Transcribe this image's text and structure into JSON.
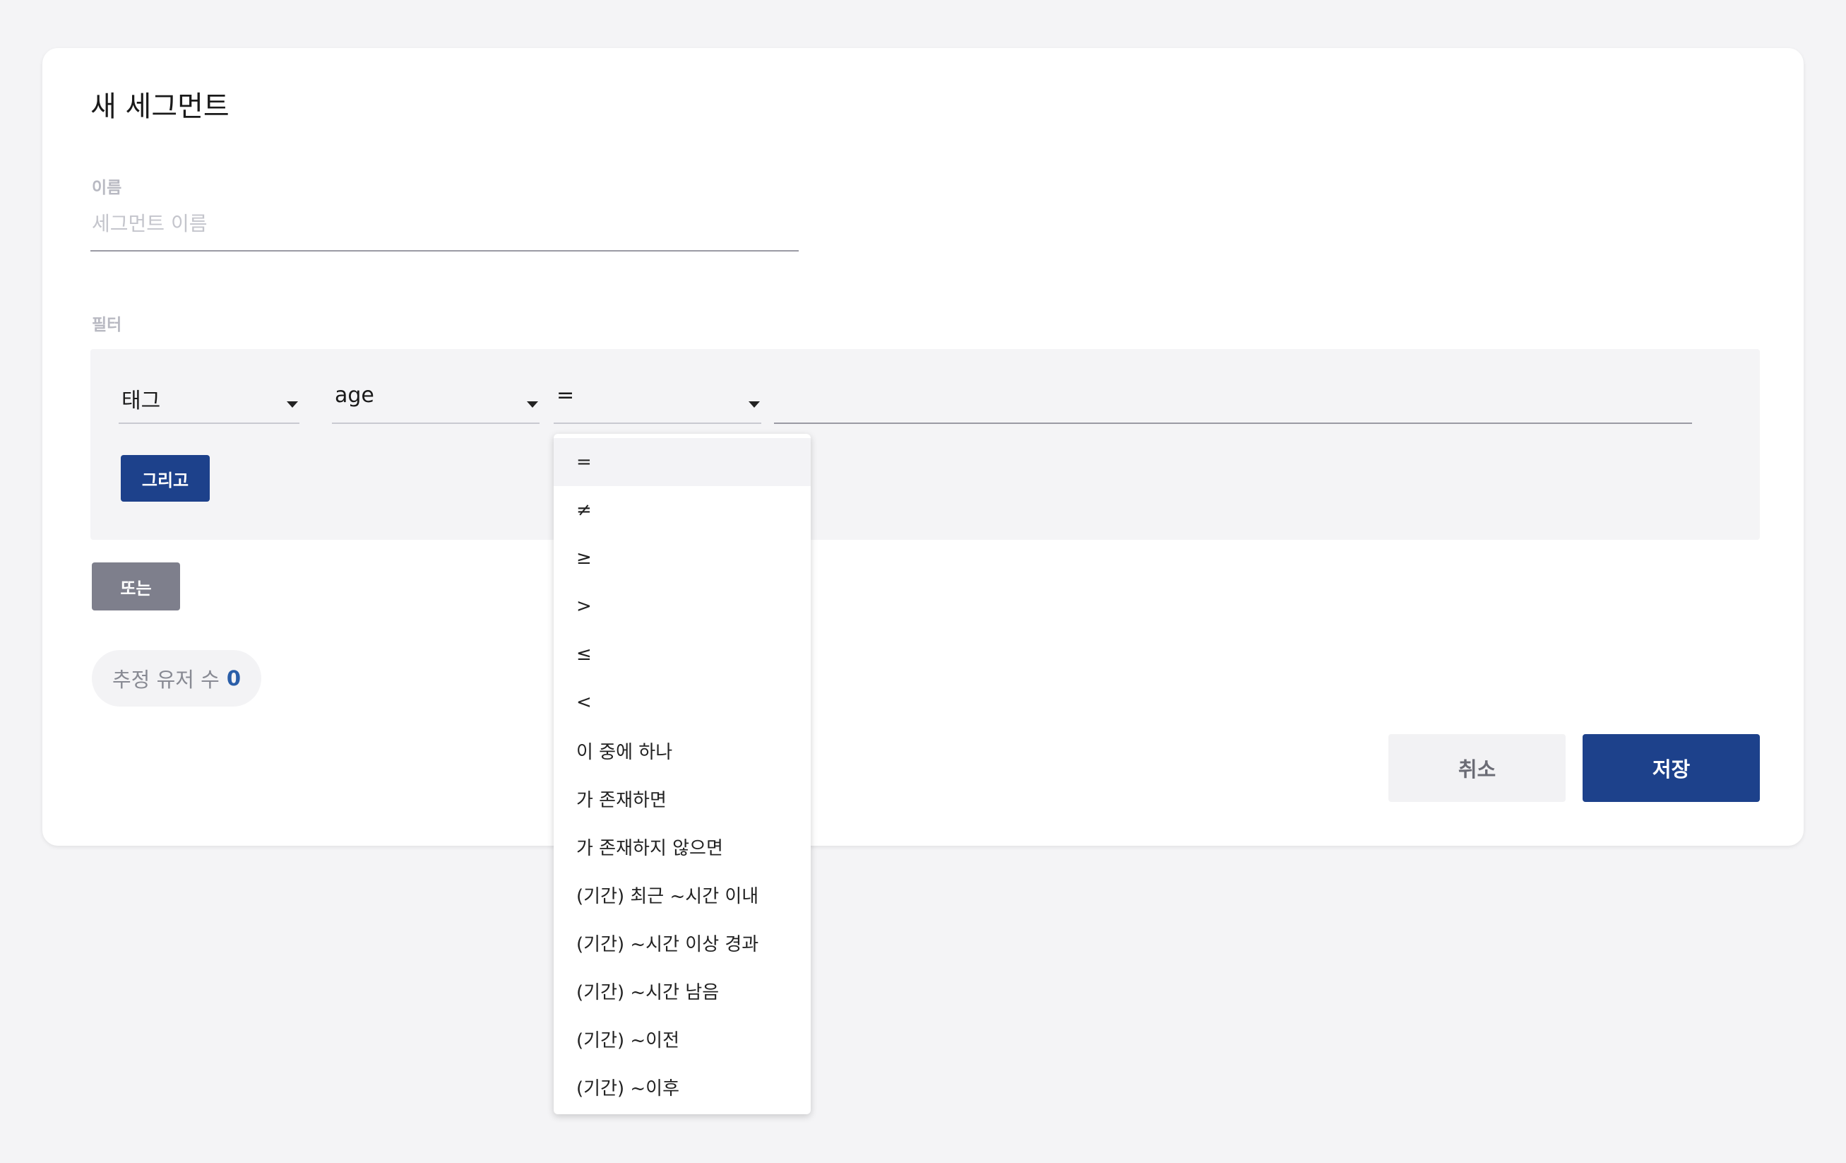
{
  "title": "새 세그먼트",
  "name_field": {
    "label": "이름",
    "placeholder": "세그먼트 이름",
    "value": ""
  },
  "filter": {
    "label": "필터",
    "type_select": "태그",
    "key_select": "age",
    "operator_select": "=",
    "value": "",
    "and_button": "그리고",
    "or_button": "또는"
  },
  "estimate": {
    "label": "추정 유저 수",
    "count": "0"
  },
  "actions": {
    "cancel": "취소",
    "save": "저장"
  },
  "operator_menu": {
    "selected_index": 0,
    "options": [
      "=",
      "≠",
      "≥",
      ">",
      "≤",
      "<",
      "이 중에 하나",
      "가 존재하면",
      "가 존재하지 않으면",
      "(기간) 최근 ~시간 이내",
      "(기간) ~시간 이상 경과",
      "(기간) ~시간 남음",
      "(기간) ~이전",
      "(기간) ~이후"
    ]
  },
  "colors": {
    "primary": "#1d418b",
    "secondary_button": "#7e7f8c",
    "estimate_count": "#2a5ea8",
    "background": "#f4f4f6"
  }
}
